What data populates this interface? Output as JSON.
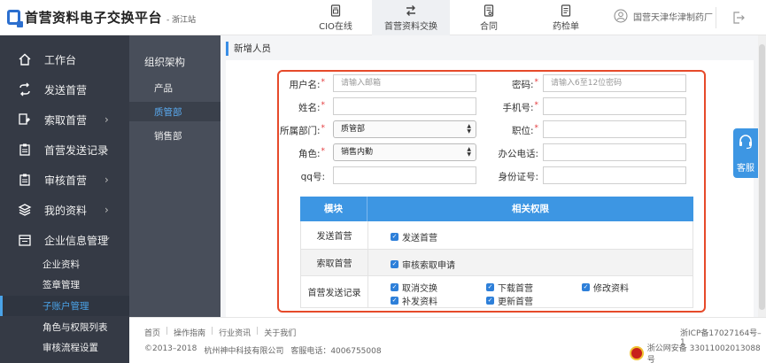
{
  "header": {
    "app_title": "首营资料电子交换平台",
    "site_suffix": "- 浙江站",
    "nav": [
      {
        "label": "CIO在线",
        "icon": "document-icon",
        "active": false
      },
      {
        "label": "首营资料交换",
        "icon": "swap-arrows-icon",
        "active": true
      },
      {
        "label": "合同",
        "icon": "contract-icon",
        "active": false
      },
      {
        "label": "药检单",
        "icon": "report-icon",
        "active": false
      }
    ],
    "user_name": "国营天津华津制药厂"
  },
  "sidebar": {
    "items": [
      {
        "label": "工作台",
        "icon": "home-icon",
        "chevron": ""
      },
      {
        "label": "发送首营",
        "icon": "send-loop-icon",
        "chevron": ""
      },
      {
        "label": "索取首营",
        "icon": "request-icon",
        "chevron": "›"
      },
      {
        "label": "首营发送记录",
        "icon": "clipboard-icon",
        "chevron": "›"
      },
      {
        "label": "审核首营",
        "icon": "clipboard-check-icon",
        "chevron": "›"
      },
      {
        "label": "我的资料",
        "icon": "layers-icon",
        "chevron": "›"
      },
      {
        "label": "企业信息管理",
        "icon": "enterprise-icon",
        "chevron": "⌄"
      }
    ],
    "sub_items": [
      {
        "label": "企业资料",
        "active": false
      },
      {
        "label": "签章管理",
        "active": false
      },
      {
        "label": "子账户管理",
        "active": true
      },
      {
        "label": "角色与权限列表",
        "active": false
      },
      {
        "label": "审核流程设置",
        "active": false
      }
    ]
  },
  "org": {
    "title": "组织架构",
    "items": [
      {
        "label": "产品",
        "active": false
      },
      {
        "label": "质管部",
        "active": true
      },
      {
        "label": "销售部",
        "active": false
      }
    ]
  },
  "main": {
    "breadcrumb": "新增人员"
  },
  "form": {
    "username": {
      "label": "用户名:",
      "required": "*",
      "placeholder": "请输入邮箱"
    },
    "password": {
      "label": "密码:",
      "required": "*",
      "placeholder": "请输入6至12位密码"
    },
    "name": {
      "label": "姓名:",
      "required": "*",
      "value": ""
    },
    "phone": {
      "label": "手机号:",
      "required": "*",
      "value": ""
    },
    "department": {
      "label": "所属部门:",
      "required": "*",
      "value": "质管部"
    },
    "position": {
      "label": "职位:",
      "required": "*",
      "value": ""
    },
    "role": {
      "label": "角色:",
      "required": "*",
      "value": "销售内勤"
    },
    "office_phone": {
      "label": "办公电话:",
      "value": ""
    },
    "qq": {
      "label": "qq号:",
      "value": ""
    },
    "id_number": {
      "label": "身份证号:",
      "value": ""
    }
  },
  "permissions": {
    "headers": [
      "模块",
      "相关权限"
    ],
    "rows": [
      {
        "module": "发送首营",
        "perms": [
          "发送首营"
        ]
      },
      {
        "module": "索取首营",
        "perms": [
          "审核索取申请"
        ]
      },
      {
        "module": "首营发送记录",
        "perms": [
          "取消交换",
          "下载首营",
          "修改资料",
          "补发资料",
          "更新首营"
        ]
      }
    ]
  },
  "service": {
    "label": "客服"
  },
  "footer": {
    "links": [
      "首页",
      "操作指南",
      "行业资讯",
      "关于我们"
    ],
    "copyright": "©2013–2018",
    "company": "杭州神中科技有限公司",
    "hotline": "客服电话：4006755008",
    "icp": "浙ICP备17027164号–1",
    "police": "浙公网安备 33011002013088号"
  },
  "colors": {
    "accent": "#3d96e3",
    "sidebar": "#353a45",
    "highlight_frame": "#e64a2a"
  }
}
